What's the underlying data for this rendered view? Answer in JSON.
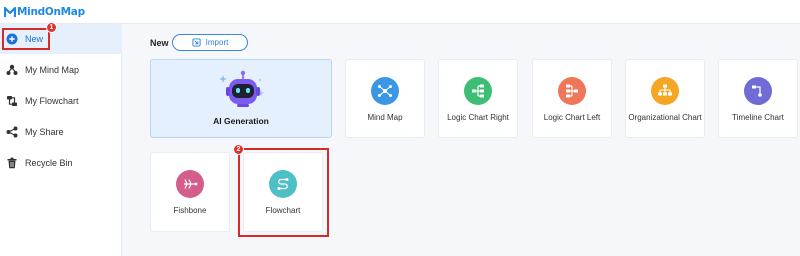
{
  "app": {
    "logo_text": "MindOnMap",
    "brand_color": "#1e88e5"
  },
  "sidebar": {
    "items": [
      {
        "label": "New",
        "icon": "plus-circle-icon",
        "active": true
      },
      {
        "label": "My Mind Map",
        "icon": "mind-map-icon"
      },
      {
        "label": "My Flowchart",
        "icon": "flowchart-icon"
      },
      {
        "label": "My Share",
        "icon": "share-icon"
      },
      {
        "label": "Recycle Bin",
        "icon": "trash-icon"
      }
    ]
  },
  "main": {
    "section_label": "New",
    "import_label": "Import",
    "templates": [
      {
        "label": "AI Generation",
        "icon": "robot-icon",
        "color": "#2d2f3a"
      },
      {
        "label": "Mind Map",
        "icon": "mind-map-icon",
        "color": "#3b97e6"
      },
      {
        "label": "Logic Chart Right",
        "icon": "logic-right-icon",
        "color": "#3cbf74"
      },
      {
        "label": "Logic Chart Left",
        "icon": "logic-left-icon",
        "color": "#f0765a"
      },
      {
        "label": "Organizational Chart",
        "icon": "org-chart-icon",
        "color": "#f5a623"
      },
      {
        "label": "Timeline Chart",
        "icon": "timeline-icon",
        "color": "#6f6cd6"
      },
      {
        "label": "Fishbone",
        "icon": "fishbone-icon",
        "color": "#d45d8c"
      },
      {
        "label": "Flowchart",
        "icon": "flowchart-icon",
        "color": "#4fbfc6"
      }
    ]
  },
  "annotations": {
    "step1": "1",
    "step2": "2",
    "highlight_color": "#d42a2a"
  }
}
